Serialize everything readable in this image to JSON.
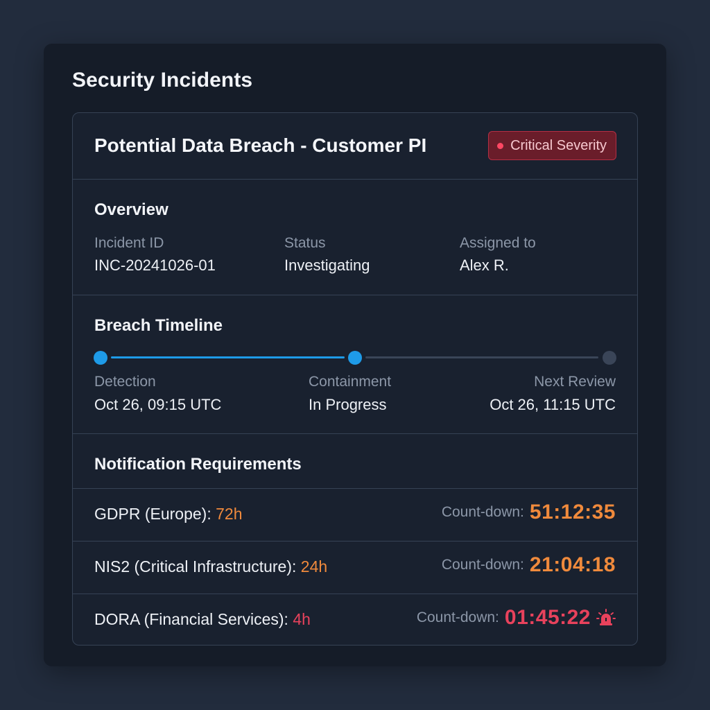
{
  "panel": {
    "title": "Security Incidents"
  },
  "incident": {
    "title": "Potential Data Breach - Customer PI",
    "severity": "Critical Severity",
    "severity_color": "#e8425c"
  },
  "overview": {
    "title": "Overview",
    "fields": [
      {
        "label": "Incident ID",
        "value": "INC-20241026-01"
      },
      {
        "label": "Status",
        "value": "Investigating"
      },
      {
        "label": "Assigned to",
        "value": "Alex R."
      }
    ]
  },
  "timeline": {
    "title": "Breach Timeline",
    "active_color": "#1e9be8",
    "stages": [
      {
        "label": "Detection",
        "value": "Oct 26, 09:15 UTC",
        "state": "complete"
      },
      {
        "label": "Containment",
        "value": "In Progress",
        "state": "current"
      },
      {
        "label": "Next Review",
        "value": "Oct 26, 11:15 UTC",
        "state": "pending"
      }
    ]
  },
  "notifications": {
    "title": "Notification Requirements",
    "countdown_label": "Count-down:",
    "items": [
      {
        "name": "GDPR (Europe): ",
        "hours": "72h",
        "countdown": "51:12:35",
        "urgency": "warning",
        "color": "#f08a3c"
      },
      {
        "name": "NIS2 (Critical Infrastructure): ",
        "hours": "24h",
        "countdown": "21:04:18",
        "urgency": "warning",
        "color": "#f08a3c"
      },
      {
        "name": "DORA (Financial Services): ",
        "hours": "4h",
        "countdown": "01:45:22",
        "urgency": "critical",
        "color": "#e8425c",
        "icon": "alarm-icon"
      }
    ]
  }
}
